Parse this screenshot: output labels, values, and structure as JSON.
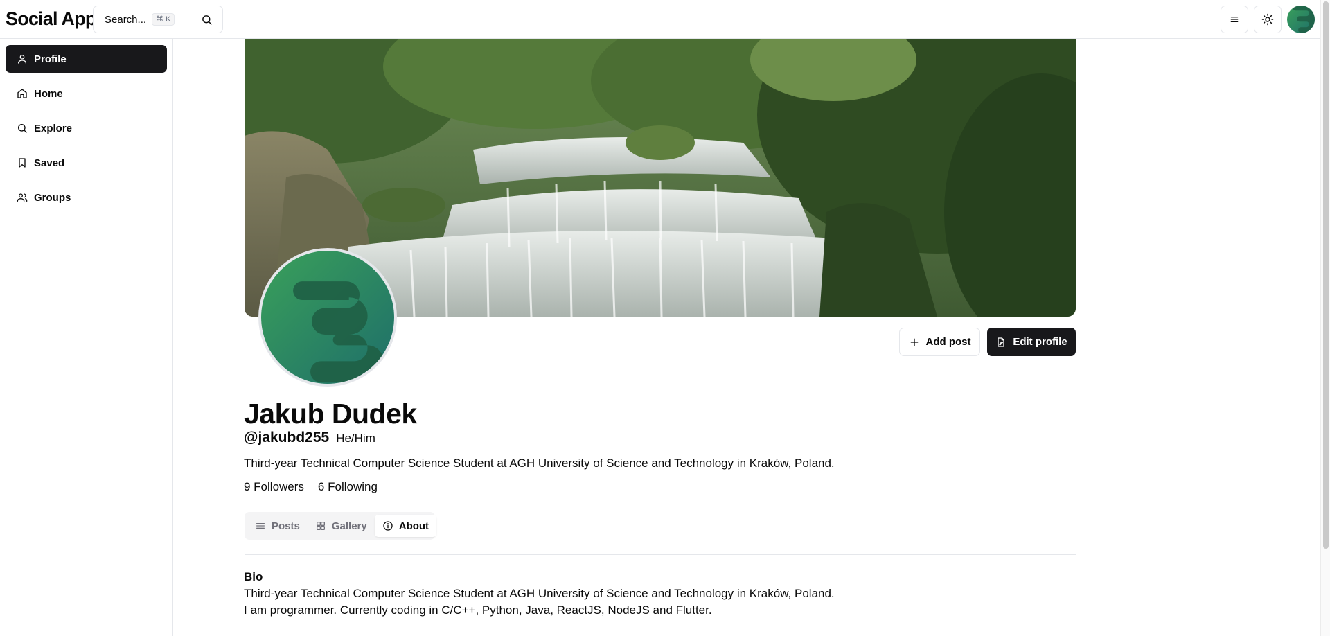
{
  "app": {
    "title": "Social App"
  },
  "search": {
    "label": "Search...",
    "shortcut": "⌘ K"
  },
  "header": {
    "menu_icon": "menu-icon",
    "theme_icon": "sun-icon"
  },
  "sidebar": {
    "items": [
      {
        "label": "Profile",
        "icon": "user-icon",
        "active": true
      },
      {
        "label": "Home",
        "icon": "home-icon",
        "active": false
      },
      {
        "label": "Explore",
        "icon": "search-icon",
        "active": false
      },
      {
        "label": "Saved",
        "icon": "bookmark-icon",
        "active": false
      },
      {
        "label": "Groups",
        "icon": "users-icon",
        "active": false
      }
    ]
  },
  "profile": {
    "name": "Jakub Dudek",
    "handle": "@jakubd255",
    "pronouns": "He/Him",
    "tagline": "Third-year Technical Computer Science Student at AGH University of Science and Technology in Kraków, Poland.",
    "followers": "9 Followers",
    "following": "6 Following"
  },
  "actions": {
    "add_post": "Add post",
    "edit_profile": "Edit profile"
  },
  "tabs": [
    {
      "label": "Posts",
      "icon": "list-icon",
      "active": false
    },
    {
      "label": "Gallery",
      "icon": "grid-icon",
      "active": false
    },
    {
      "label": "About",
      "icon": "info-icon",
      "active": true
    }
  ],
  "about": {
    "bio_title": "Bio",
    "bio_lines": [
      "Third-year Technical Computer Science Student at AGH University of Science and Technology in Kraków, Poland.",
      "I am programmer. Currently coding in C/C++, Python, Java, ReactJS, NodeJS and Flutter."
    ]
  },
  "colors": {
    "primary": "#18181b",
    "border": "#e5e7eb",
    "muted": "#71717a",
    "avatar_green": "#2e8b57"
  }
}
